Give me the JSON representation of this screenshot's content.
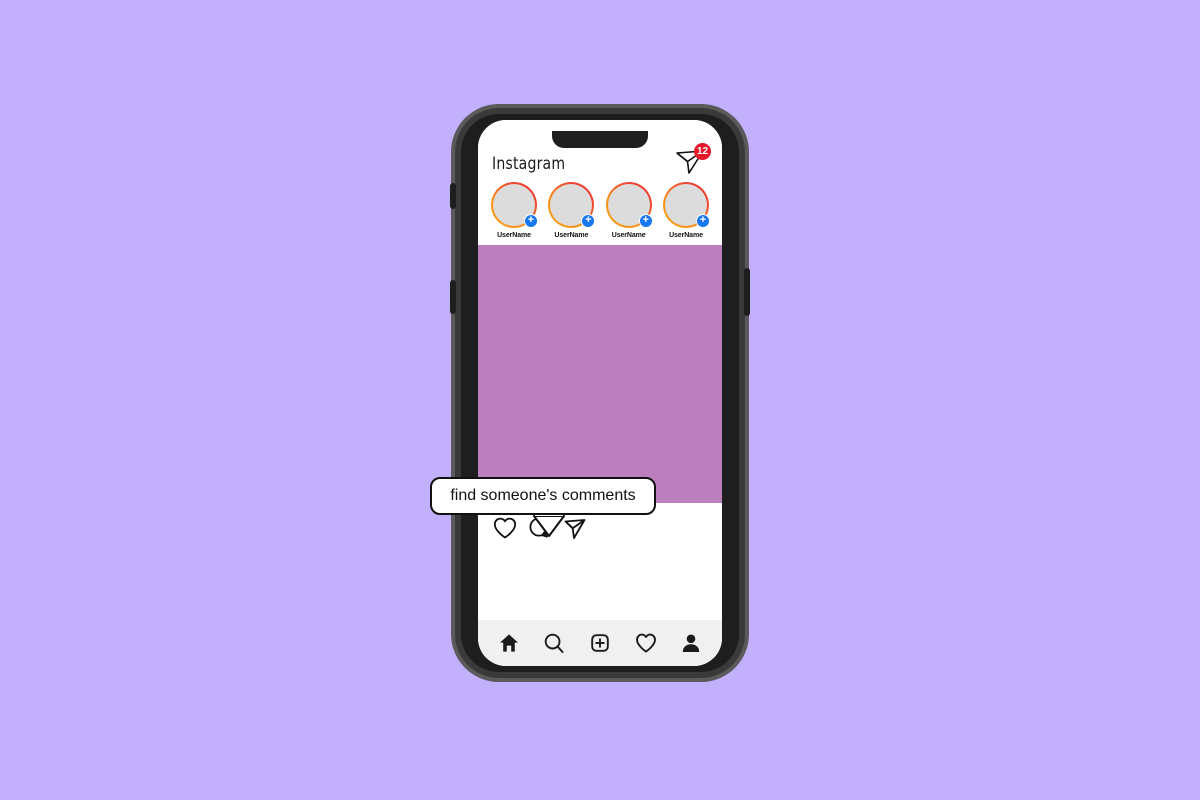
{
  "page": {
    "background_color": "#c2b0fc"
  },
  "phone": {
    "frame_color": "#3a3a3a",
    "bezel_color": "#1e1e1e",
    "buttons": [
      {
        "name": "volume-up",
        "label": "Volume Up"
      },
      {
        "name": "volume-down",
        "label": "Volume Down"
      },
      {
        "name": "power",
        "label": "Power"
      }
    ]
  },
  "app": {
    "header": {
      "title": "Instagram",
      "share_icon": "paper-plane-icon",
      "notification_badge": "12",
      "badge_color": "#e5172b"
    },
    "stories": [
      {
        "username": "UserName",
        "badge": "+",
        "avatar_color": "#dcdcdc"
      },
      {
        "username": "UserName",
        "badge": "+",
        "avatar_color": "#dcdcdc"
      },
      {
        "username": "UserName",
        "badge": "+",
        "avatar_color": "#dcdcdc"
      },
      {
        "username": "UserName",
        "badge": "+",
        "avatar_color": "#dcdcdc"
      }
    ],
    "post": {
      "image_color": "#bd7ebe",
      "actions": [
        {
          "name": "like",
          "icon": "heart-icon"
        },
        {
          "name": "comment",
          "icon": "comment-bubble-icon"
        },
        {
          "name": "share",
          "icon": "paper-plane-icon"
        }
      ]
    },
    "bottom_nav": [
      {
        "name": "home",
        "icon": "home-icon"
      },
      {
        "name": "search",
        "icon": "search-icon"
      },
      {
        "name": "create",
        "icon": "plus-square-icon"
      },
      {
        "name": "activity",
        "icon": "heart-icon"
      },
      {
        "name": "profile",
        "icon": "person-icon"
      }
    ]
  },
  "callout": {
    "text": "find someone's comments"
  }
}
